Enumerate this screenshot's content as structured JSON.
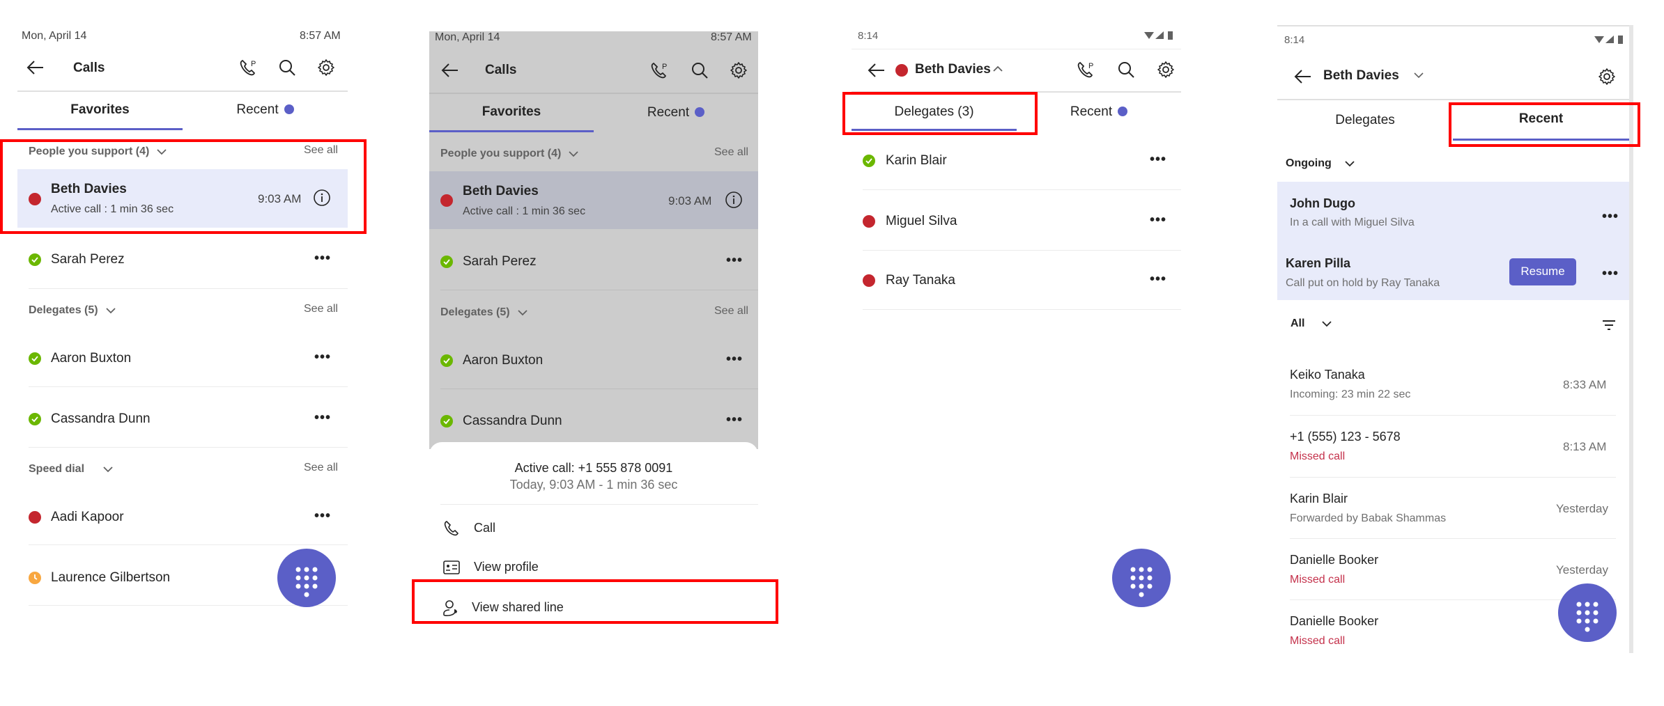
{
  "panel1": {
    "status": {
      "date": "Mon, April 14",
      "time": "8:57 AM"
    },
    "header": {
      "title": "Calls",
      "icons": [
        "back-arrow-icon",
        "call-park-icon",
        "search-icon",
        "gear-icon"
      ]
    },
    "tabs": [
      {
        "label": "Favorites",
        "active": true
      },
      {
        "label": "Recent",
        "active": false,
        "badge": true
      }
    ],
    "sections": [
      {
        "title": "People you support (4)",
        "see_all": "See all",
        "items": [
          {
            "name": "Beth Davies",
            "subtitle": "Active call : 1 min 36 sec",
            "time": "9:03 AM",
            "presence": "busy",
            "highlighted": true,
            "action": "info-icon"
          },
          {
            "name": "Sarah Perez",
            "presence": "available",
            "action": "more-icon"
          }
        ]
      },
      {
        "title": "Delegates (5)",
        "see_all": "See all",
        "items": [
          {
            "name": "Aaron Buxton",
            "presence": "available",
            "action": "more-icon"
          },
          {
            "name": "Cassandra Dunn",
            "presence": "available",
            "action": "more-icon"
          }
        ]
      },
      {
        "title": "Speed dial",
        "see_all": "See all",
        "items": [
          {
            "name": "Aadi Kapoor",
            "presence": "busy",
            "action": "more-icon"
          },
          {
            "name": "Laurence Gilbertson",
            "presence": "away"
          }
        ]
      }
    ],
    "fab": "dialpad-icon"
  },
  "panel2": {
    "status": {
      "date": "Mon, April 14",
      "time": "8:57 AM"
    },
    "header": {
      "title": "Calls"
    },
    "tabs": [
      {
        "label": "Favorites",
        "active": true
      },
      {
        "label": "Recent",
        "active": false,
        "badge": true
      }
    ],
    "sections": [
      {
        "title": "People you support (4)",
        "see_all": "See all",
        "items": [
          {
            "name": "Beth Davies",
            "subtitle": "Active call : 1 min 36 sec",
            "time": "9:03 AM",
            "presence": "busy",
            "highlighted": true
          },
          {
            "name": "Sarah Perez",
            "presence": "available"
          }
        ]
      },
      {
        "title": "Delegates (5)",
        "see_all": "See all",
        "items": [
          {
            "name": "Aaron Buxton",
            "presence": "available"
          },
          {
            "name": "Cassandra Dunn",
            "presence": "available"
          }
        ]
      }
    ],
    "sheet": {
      "title": "Active call: +1 555 878 0091",
      "subtitle": "Today, 9:03 AM - 1 min 36 sec",
      "actions": [
        {
          "label": "Call",
          "icon": "phone-icon"
        },
        {
          "label": "View profile",
          "icon": "contact-card-icon"
        },
        {
          "label": "View shared line",
          "icon": "shared-line-icon",
          "highlighted": true
        }
      ]
    }
  },
  "panel3": {
    "status": {
      "time": "8:14"
    },
    "header": {
      "title": "Beth Davies",
      "presence": "busy",
      "chevron": "up"
    },
    "tabs": [
      {
        "label": "Delegates (3)",
        "active": true
      },
      {
        "label": "Recent",
        "active": false,
        "badge": true
      }
    ],
    "delegates": [
      {
        "name": "Karin Blair",
        "presence": "available"
      },
      {
        "name": "Miguel Silva",
        "presence": "busy"
      },
      {
        "name": "Ray Tanaka",
        "presence": "busy"
      }
    ],
    "fab": "dialpad-icon"
  },
  "panel4": {
    "status": {
      "time": "8:14"
    },
    "header": {
      "title": "Beth Davies",
      "chevron": "down"
    },
    "tabs": [
      {
        "label": "Delegates",
        "active": false
      },
      {
        "label": "Recent",
        "active": true
      }
    ],
    "ongoing": {
      "label": "Ongoing",
      "items": [
        {
          "name": "John Dugo",
          "subtitle": "In a call with Miguel Silva"
        },
        {
          "name": "Karen Pilla",
          "subtitle": "Call put on hold by Ray Tanaka",
          "button": "Resume"
        }
      ]
    },
    "filter": {
      "label": "All"
    },
    "recent": [
      {
        "name": "Keiko Tanaka",
        "subtitle": "Incoming: 23 min 22 sec",
        "time": "8:33 AM",
        "missed": false
      },
      {
        "name": "+1 (555) 123 - 5678",
        "subtitle": "Missed call",
        "time": "8:13 AM",
        "missed": true
      },
      {
        "name": "Karin Blair",
        "subtitle": "Forwarded by Babak Shammas",
        "time": "Yesterday",
        "missed": false
      },
      {
        "name": "Danielle Booker",
        "subtitle": "Missed call",
        "time": "Yesterday",
        "missed": true
      },
      {
        "name": "Danielle Booker",
        "subtitle": "Missed call",
        "time": "",
        "missed": true
      }
    ],
    "fab": "dialpad-icon"
  },
  "colors": {
    "brand": "#5b5fc7",
    "busy": "#c4262e",
    "available": "#6bb700",
    "away": "#f8a740",
    "missed": "#c4314b",
    "highlight": "#e8ebfa",
    "annotation": "#ff0000"
  }
}
